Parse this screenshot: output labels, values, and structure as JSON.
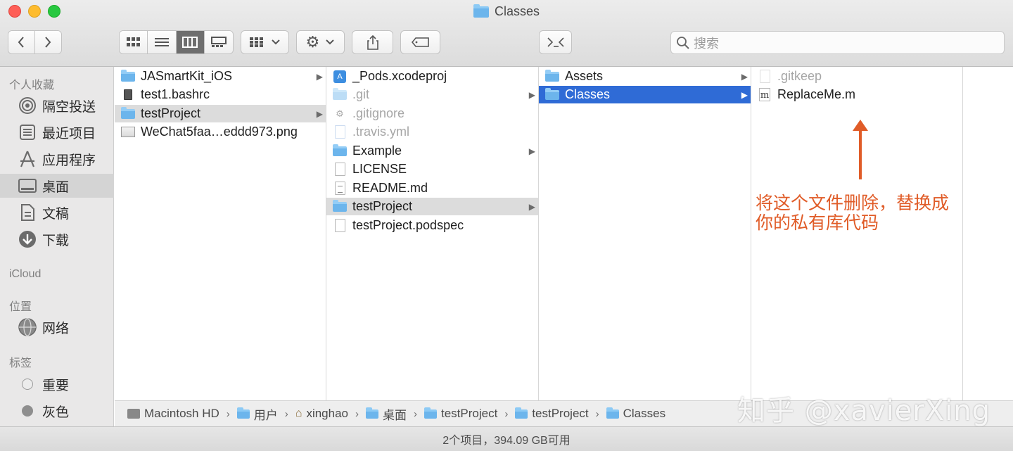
{
  "window": {
    "title": "Classes"
  },
  "toolbar": {
    "back_icon": "chevron-left-icon",
    "forward_icon": "chevron-right-icon",
    "search_placeholder": "搜索"
  },
  "sidebar": {
    "favorites_header": "个人收藏",
    "favorites": [
      {
        "label": "隔空投送",
        "icon": "airdrop-icon"
      },
      {
        "label": "最近项目",
        "icon": "recents-icon"
      },
      {
        "label": "应用程序",
        "icon": "applications-icon"
      },
      {
        "label": "桌面",
        "icon": "desktop-icon",
        "selected": true
      },
      {
        "label": "文稿",
        "icon": "documents-icon"
      },
      {
        "label": "下载",
        "icon": "downloads-icon"
      }
    ],
    "icloud_header": "iCloud",
    "locations_header": "位置",
    "locations": [
      {
        "label": "网络",
        "icon": "network-icon"
      }
    ],
    "tags_header": "标签",
    "tags": [
      {
        "label": "重要",
        "color": "#ffffff"
      },
      {
        "label": "灰色",
        "color": "#8e8e8e"
      }
    ]
  },
  "columns": [
    {
      "items": [
        {
          "name": "JASmartKit_iOS",
          "kind": "folder",
          "arrow": true
        },
        {
          "name": "test1.bashrc",
          "kind": "doc-dark"
        },
        {
          "name": "testProject",
          "kind": "folder",
          "arrow": true,
          "state": "gray"
        },
        {
          "name": "WeChat5faa…eddd973.png",
          "kind": "image"
        }
      ]
    },
    {
      "items": [
        {
          "name": "_Pods.xcodeproj",
          "kind": "xcode"
        },
        {
          "name": ".git",
          "kind": "folder",
          "arrow": true,
          "dim": true
        },
        {
          "name": ".gitignore",
          "kind": "gear",
          "dim": true
        },
        {
          "name": ".travis.yml",
          "kind": "doc",
          "dim": true
        },
        {
          "name": "Example",
          "kind": "folder",
          "arrow": true
        },
        {
          "name": "LICENSE",
          "kind": "doc"
        },
        {
          "name": "README.md",
          "kind": "doc-lines"
        },
        {
          "name": "testProject",
          "kind": "folder",
          "arrow": true,
          "state": "gray"
        },
        {
          "name": "testProject.podspec",
          "kind": "doc"
        }
      ]
    },
    {
      "items": [
        {
          "name": "Assets",
          "kind": "folder",
          "arrow": true
        },
        {
          "name": "Classes",
          "kind": "folder",
          "arrow": true,
          "state": "blue"
        }
      ]
    },
    {
      "items": [
        {
          "name": ".gitkeep",
          "kind": "doc",
          "dim": true
        },
        {
          "name": "ReplaceMe.m",
          "kind": "m-file"
        }
      ]
    }
  ],
  "annotation": {
    "line1": "将这个文件删除，替换成",
    "line2": "你的私有库代码",
    "color": "#e05c28"
  },
  "pathbar": [
    {
      "label": "Macintosh HD",
      "icon": "hard-drive-icon"
    },
    {
      "label": "用户",
      "icon": "folder-icon"
    },
    {
      "label": "xinghao",
      "icon": "home-icon"
    },
    {
      "label": "桌面",
      "icon": "folder-icon"
    },
    {
      "label": "testProject",
      "icon": "folder-icon"
    },
    {
      "label": "testProject",
      "icon": "folder-icon"
    },
    {
      "label": "Classes",
      "icon": "folder-icon"
    }
  ],
  "watermark": "知乎 @xavierXing",
  "status": {
    "text": "2个项目，394.09 GB可用"
  }
}
